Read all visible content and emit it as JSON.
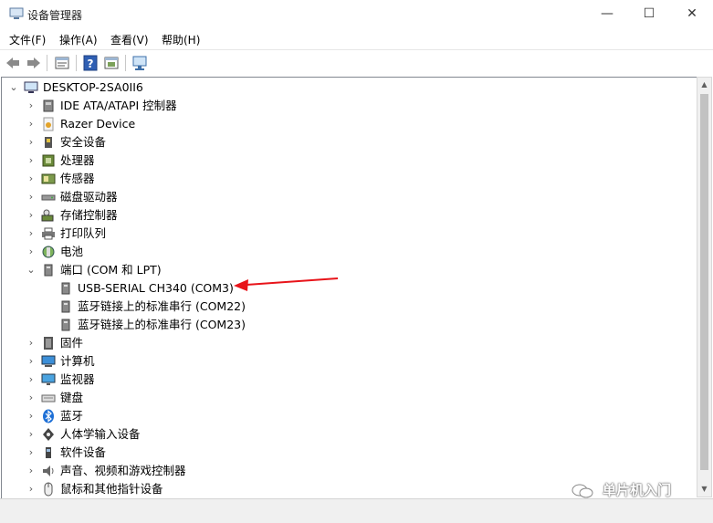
{
  "window": {
    "title": "设备管理器",
    "minimize": "—",
    "maximize": "☐",
    "close": "✕"
  },
  "menu": [
    "文件(F)",
    "操作(A)",
    "查看(V)",
    "帮助(H)"
  ],
  "tree": {
    "root": "DESKTOP-2SA0II6",
    "items": [
      {
        "label": "IDE ATA/ATAPI 控制器",
        "expanded": false,
        "icon": "ide-controller-icon"
      },
      {
        "label": "Razer Device",
        "expanded": false,
        "icon": "razer-device-icon"
      },
      {
        "label": "安全设备",
        "expanded": false,
        "icon": "security-device-icon"
      },
      {
        "label": "处理器",
        "expanded": false,
        "icon": "processor-icon"
      },
      {
        "label": "传感器",
        "expanded": false,
        "icon": "sensor-icon"
      },
      {
        "label": "磁盘驱动器",
        "expanded": false,
        "icon": "disk-drive-icon"
      },
      {
        "label": "存储控制器",
        "expanded": false,
        "icon": "storage-controller-icon"
      },
      {
        "label": "打印队列",
        "expanded": false,
        "icon": "printer-icon"
      },
      {
        "label": "电池",
        "expanded": false,
        "icon": "battery-icon"
      },
      {
        "label": "端口 (COM 和 LPT)",
        "expanded": true,
        "icon": "port-icon",
        "children": [
          "USB-SERIAL CH340 (COM3)",
          "蓝牙链接上的标准串行 (COM22)",
          "蓝牙链接上的标准串行 (COM23)"
        ]
      },
      {
        "label": "固件",
        "expanded": false,
        "icon": "firmware-icon"
      },
      {
        "label": "计算机",
        "expanded": false,
        "icon": "computer-icon"
      },
      {
        "label": "监视器",
        "expanded": false,
        "icon": "monitor-icon"
      },
      {
        "label": "键盘",
        "expanded": false,
        "icon": "keyboard-icon"
      },
      {
        "label": "蓝牙",
        "expanded": false,
        "icon": "bluetooth-icon"
      },
      {
        "label": "人体学输入设备",
        "expanded": false,
        "icon": "hid-icon"
      },
      {
        "label": "软件设备",
        "expanded": false,
        "icon": "software-device-icon"
      },
      {
        "label": "声音、视频和游戏控制器",
        "expanded": false,
        "icon": "sound-icon"
      },
      {
        "label": "鼠标和其他指针设备",
        "expanded": false,
        "icon": "mouse-icon"
      }
    ]
  },
  "watermark": "单片机入门",
  "colors": {
    "annotation_arrow": "#e8141a",
    "scroll_thumb": "#c2c2c2"
  }
}
